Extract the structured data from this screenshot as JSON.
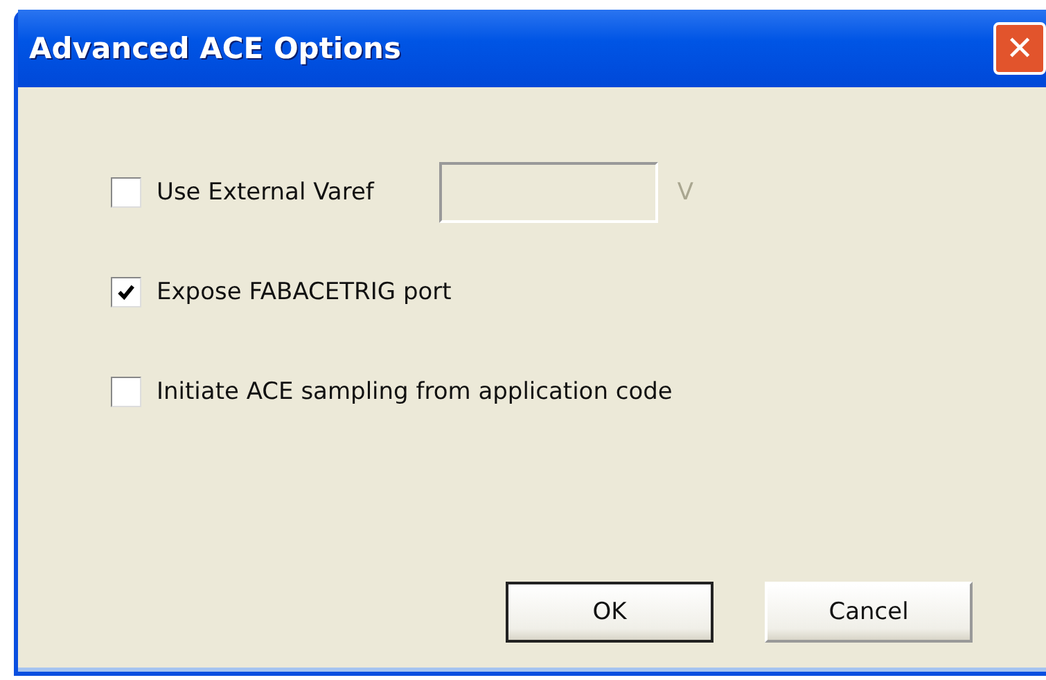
{
  "window": {
    "title": "Advanced ACE Options",
    "close_label": "✕"
  },
  "options": [
    {
      "kind": "checkbox-field",
      "label": "Use External Varef",
      "checked": false,
      "field": {
        "disabled": true,
        "unit": "V"
      }
    },
    {
      "kind": "checkbox",
      "label": "Expose FABACETRIG port",
      "checked": true
    },
    {
      "kind": "checkbox",
      "label": "Initiate ACE sampling from application code",
      "checked": false
    }
  ],
  "buttons": [
    {
      "label": "OK",
      "default": true
    },
    {
      "label": "Cancel",
      "default": false
    }
  ]
}
